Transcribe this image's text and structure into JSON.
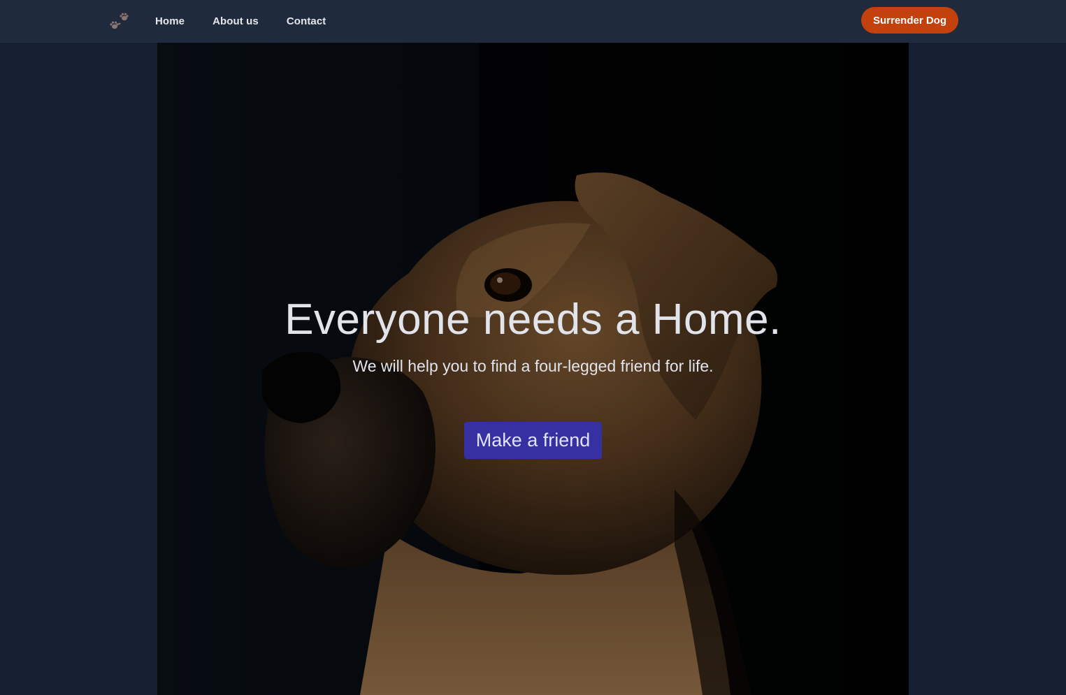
{
  "nav": {
    "logo_icon": "paw-prints-icon",
    "links": [
      {
        "label": "Home"
      },
      {
        "label": "About us"
      },
      {
        "label": "Contact"
      }
    ],
    "cta_label": "Surrender Dog"
  },
  "hero": {
    "image": "dog-portrait-photo",
    "title": "Everyone needs a Home.",
    "subtitle": "We will help you to find a four-legged friend for life.",
    "button_label": "Make a friend"
  },
  "colors": {
    "page_bg": "#172033",
    "navbar_bg": "#1f2a3c",
    "cta_bg": "#c2410c",
    "primary_button_bg": "#3730a3",
    "hero_text": "#e2e4ec"
  }
}
